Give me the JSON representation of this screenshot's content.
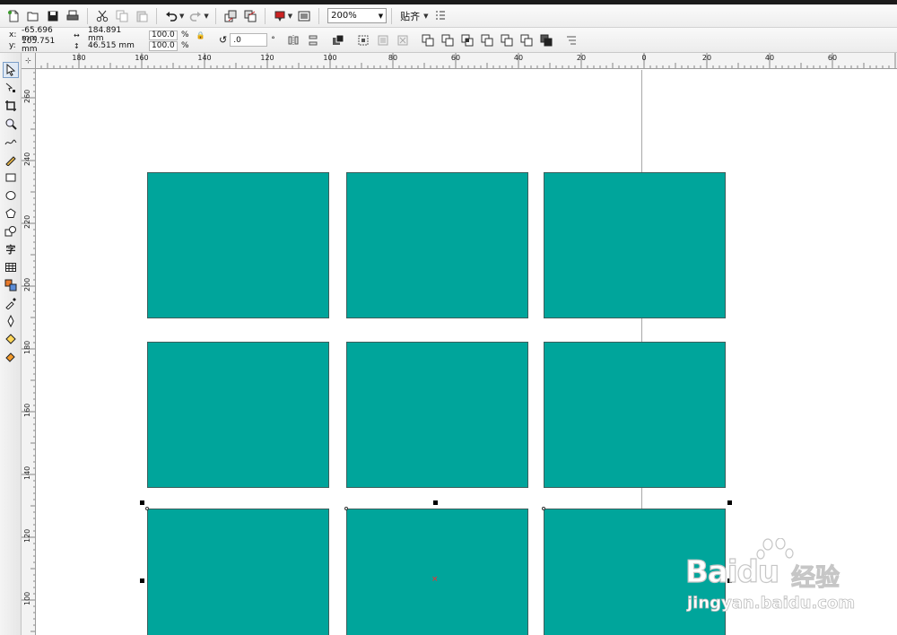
{
  "toolbar": {
    "zoom_value": "200%",
    "snap_label": "贴齐"
  },
  "property_bar": {
    "x_label": "x:",
    "x_value": "-65.696 mm",
    "y_label": "y:",
    "y_value": "105.751 mm",
    "width_value": "184.891 mm",
    "height_value": "46.515 mm",
    "scale_x": "100.0",
    "scale_y": "100.0",
    "percent": "%",
    "rotation_value": ".0",
    "degree": "°"
  },
  "ruler": {
    "horizontal_labels": [
      "180",
      "160",
      "140",
      "120",
      "100",
      "80",
      "60",
      "40",
      "20",
      "0",
      "20",
      "40",
      "60"
    ],
    "vertical_labels": [
      "260",
      "240",
      "220",
      "200",
      "180",
      "160",
      "140",
      "120",
      "100"
    ]
  },
  "toolbox": {
    "text_tool_glyph": "字"
  },
  "canvas": {
    "fill_color": "#00a59b",
    "outline_color": "#3d5f5c",
    "rectangles_count_visible": 9
  },
  "watermark": {
    "brand": "Baidu",
    "brand_cn": "经验",
    "url": "jingyan.baidu.com"
  },
  "colors": {
    "teal": "#00a59b",
    "toolbar_bg": "#f0f0f0",
    "guide": "#a8a8a8"
  }
}
